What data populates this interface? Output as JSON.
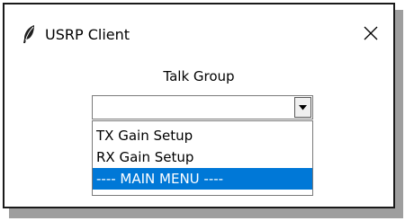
{
  "window": {
    "title": "USRP Client",
    "app_icon": "feather-icon",
    "close_icon": "close-icon"
  },
  "talk_group": {
    "label": "Talk Group",
    "selected_value": "",
    "arrow_icon": "chevron-down-icon",
    "options": [
      {
        "label": "TX Gain Setup",
        "selected": false
      },
      {
        "label": "RX Gain Setup",
        "selected": false
      },
      {
        "label": "---- MAIN MENU ----",
        "selected": true
      }
    ]
  },
  "colors": {
    "selection_background": "#0078d7",
    "selection_text": "#ffffff"
  }
}
